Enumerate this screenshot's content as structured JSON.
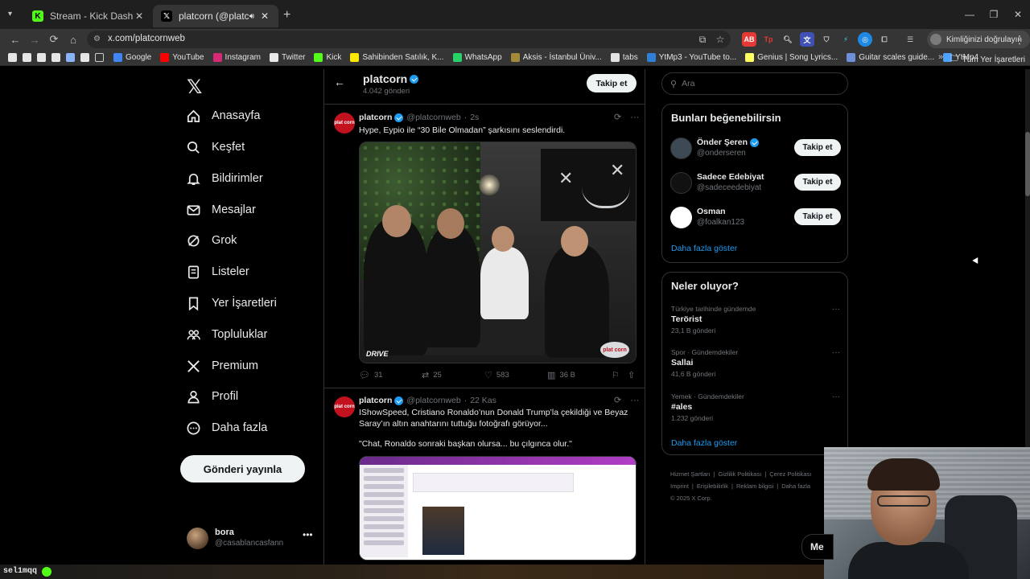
{
  "browser": {
    "tabs": [
      {
        "label": "Stream - Kick Dashboard",
        "favicon": "kick-icon",
        "active": false
      },
      {
        "label": "platcorn (@platcornweb) / X",
        "favicon": "x-icon",
        "active": true
      }
    ],
    "url": "x.com/platcornweb",
    "profile_chip": "Kimliğinizi doğrulayın",
    "bookmarks": [
      {
        "label": "Google",
        "icon": "google-icon",
        "color": "#4285f4"
      },
      {
        "label": "YouTube",
        "icon": "youtube-icon",
        "color": "#ff0000"
      },
      {
        "label": "Instagram",
        "icon": "instagram-icon",
        "color": "#d62976"
      },
      {
        "label": "Twitter",
        "icon": "x-icon",
        "color": "#e7e9ea"
      },
      {
        "label": "Kick",
        "icon": "kick-icon",
        "color": "#53fc18"
      },
      {
        "label": "Sahibinden Satılık, K...",
        "icon": "sahibinden-icon",
        "color": "#ffe800"
      },
      {
        "label": "WhatsApp",
        "icon": "whatsapp-icon",
        "color": "#25d366"
      },
      {
        "label": "Aksis - İstanbul Üniv...",
        "icon": "aksis-icon",
        "color": "#a38a3b"
      },
      {
        "label": "tabs",
        "icon": "tabs-icon",
        "color": "#e3e3e3"
      },
      {
        "label": "YtMp3 - YouTube to...",
        "icon": "ytmp3-icon",
        "color": "#2f7fd6"
      },
      {
        "label": "Genius | Song Lyrics...",
        "icon": "genius-icon",
        "color": "#ffff64"
      },
      {
        "label": "Guitar scales guide...",
        "icon": "guitar-icon",
        "color": "#6f8fd8"
      },
      {
        "label": "YtMp4",
        "icon": "cloud-icon",
        "color": "#4fa3ff"
      }
    ],
    "bookmarks_all": "Tüm Yer İşaretleri"
  },
  "nav": {
    "items": [
      {
        "label": "Anasayfa",
        "icon": "home-icon"
      },
      {
        "label": "Keşfet",
        "icon": "search-icon"
      },
      {
        "label": "Bildirimler",
        "icon": "bell-icon"
      },
      {
        "label": "Mesajlar",
        "icon": "mail-icon"
      },
      {
        "label": "Grok",
        "icon": "grok-icon"
      },
      {
        "label": "Listeler",
        "icon": "list-icon"
      },
      {
        "label": "Yer İşaretleri",
        "icon": "bookmark-icon"
      },
      {
        "label": "Topluluklar",
        "icon": "communities-icon"
      },
      {
        "label": "Premium",
        "icon": "x-icon"
      },
      {
        "label": "Profil",
        "icon": "profile-icon"
      },
      {
        "label": "Daha fazla",
        "icon": "more-circle-icon"
      }
    ],
    "post_button": "Gönderi yayınla",
    "account": {
      "name": "bora",
      "handle": "@casablancasfann"
    }
  },
  "profile_header": {
    "name": "platcorn",
    "post_count": "4.042 gönderi",
    "follow_label": "Takip et"
  },
  "tweets": [
    {
      "name": "platcorn",
      "handle": "@platcornweb",
      "time": "2s",
      "text": "Hype, Eypio ile “30 Bile Olmadan” şarkısını seslendirdi.",
      "avatar_text": "plat corn",
      "media_watermark_left": "DRIVE",
      "media_watermark_right": "plat corn",
      "stats": {
        "replies": "31",
        "reposts": "25",
        "likes": "583",
        "views": "36 B"
      }
    },
    {
      "name": "platcorn",
      "handle": "@platcornweb",
      "time": "22 Kas",
      "text": "IShowSpeed, Cristiano Ronaldo’nun Donald Trump’la çekildiği ve Beyaz Saray’ın altın anahtarını tuttuğu fotoğrafı görüyor...",
      "quote": "\"Chat, Ronaldo sonraki başkan olursa... bu çılgınca olur.\"",
      "avatar_text": "plat corn"
    }
  ],
  "right": {
    "search_placeholder": "Ara",
    "suggestions_title": "Bunları beğenebilirsin",
    "suggestions": [
      {
        "name": "Önder Şeren",
        "handle": "@onderseren",
        "verified": true,
        "follow": "Takip et",
        "avatar_color": "#3d4a55"
      },
      {
        "name": "Sadece Edebiyat",
        "handle": "@sadeceedebiyat",
        "verified": false,
        "follow": "Takip et",
        "avatar_color": "#111111"
      },
      {
        "name": "Osman",
        "handle": "@foalkan123",
        "verified": false,
        "follow": "Takip et",
        "avatar_color": "#ffffff"
      }
    ],
    "show_more": "Daha fazla göster",
    "trends_title": "Neler oluyor?",
    "trends": [
      {
        "context": "Türkiye tarihinde gündemde",
        "name": "Terörist",
        "count": "23,1 B gönderi"
      },
      {
        "context": "Spor · Gündemdekiler",
        "name": "Sallai",
        "count": "41,6 B gönderi"
      },
      {
        "context": "Yemek · Gündemdekiler",
        "name": "#ales",
        "count": "1.232 gönderi"
      }
    ],
    "trends_more": "Daha fazla göster",
    "footer": [
      "Hizmet Şartları",
      "Gizlilik Politikası",
      "Çerez Politikası",
      "Imprint",
      "Erişilebilirlik",
      "Reklam bilgisi",
      "Daha fazla"
    ],
    "copyright": "© 2025 X Corp."
  },
  "overlay": {
    "message_chip": "Me",
    "chat_user": "sel1mqq :"
  },
  "colors": {
    "accent": "#1d9bf0",
    "brand_red": "#c2121f",
    "kick_green": "#53fc18"
  }
}
